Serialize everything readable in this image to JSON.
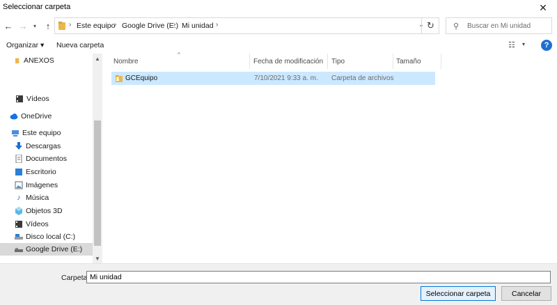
{
  "window": {
    "title": "Seleccionar carpeta",
    "close_glyph": "✕"
  },
  "address": {
    "breadcrumbs": [
      "Este equipo",
      "Google Drive (E:)",
      "Mi unidad"
    ],
    "search_placeholder": "Buscar en Mi unidad"
  },
  "toolbar": {
    "organize_label": "Organizar ▾",
    "new_folder_label": "Nueva carpeta",
    "help_glyph": "?"
  },
  "sidebar": {
    "items": [
      {
        "label": "ANEXOS",
        "icon": "folder-icon"
      },
      {
        "label": "Vídeos",
        "icon": "video-icon"
      },
      {
        "label": "OneDrive",
        "icon": "cloud-icon"
      },
      {
        "label": "Este equipo",
        "icon": "computer-icon"
      },
      {
        "label": "Descargas",
        "icon": "download-icon"
      },
      {
        "label": "Documentos",
        "icon": "document-icon"
      },
      {
        "label": "Escritorio",
        "icon": "desktop-icon"
      },
      {
        "label": "Imágenes",
        "icon": "picture-icon"
      },
      {
        "label": "Música",
        "icon": "music-icon"
      },
      {
        "label": "Objetos 3D",
        "icon": "cube-icon"
      },
      {
        "label": "Vídeos",
        "icon": "video-icon"
      },
      {
        "label": "Disco local (C:)",
        "icon": "drive-icon"
      },
      {
        "label": "Google Drive (E:)",
        "icon": "drive-icon",
        "selected": true
      }
    ]
  },
  "list": {
    "columns": [
      "Nombre",
      "Fecha de modificación",
      "Tipo",
      "Tamaño"
    ],
    "rows": [
      {
        "name": "GCEquipo",
        "date": "7/10/2021 9:33 a. m.",
        "type": "Carpeta de archivos",
        "size": ""
      }
    ]
  },
  "footer": {
    "folder_label": "Carpeta:",
    "folder_value": "Mi unidad",
    "select_button": "Seleccionar carpeta",
    "cancel_button": "Cancelar"
  },
  "colors": {
    "accent": "#0078d7",
    "selection": "#cce8ff",
    "sidebar_selected": "#d9d9d9",
    "folder": "#e8b84a"
  }
}
